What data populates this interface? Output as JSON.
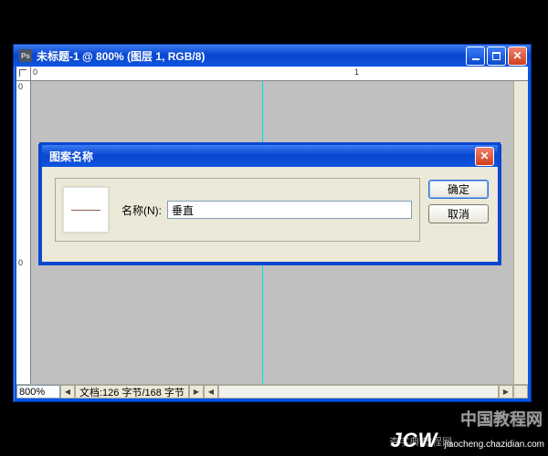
{
  "window": {
    "title": "未标题-1 @ 800% (图层 1, RGB/8)",
    "zoom": "800%",
    "doc_info": "文档:126 字节/168 字节"
  },
  "ruler": {
    "marks": [
      "0",
      "1"
    ],
    "v_zero": "0"
  },
  "dialog": {
    "title": "图案名称",
    "name_label": "名称(N):",
    "name_value": "垂直",
    "ok": "确定",
    "cancel": "取消"
  },
  "watermark": {
    "line1": "中国教程网",
    "brand": "JCW",
    "brand_sub": "jiaocheng.chazidian.com",
    "mid": "查字典   教程网"
  }
}
